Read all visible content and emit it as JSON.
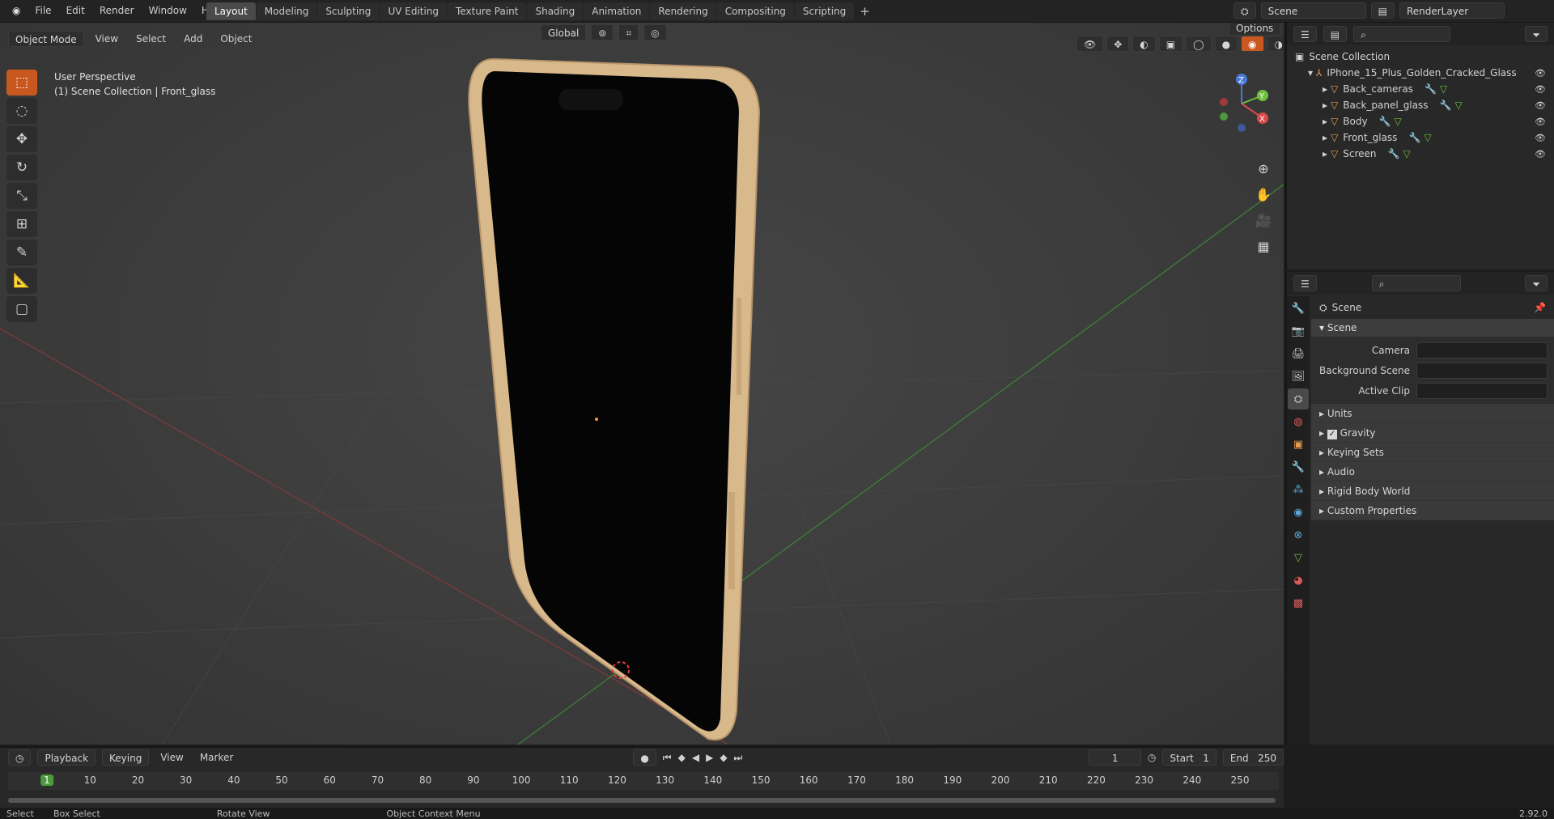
{
  "menu": [
    "File",
    "Edit",
    "Render",
    "Window",
    "Help"
  ],
  "workspace_tabs": [
    "Layout",
    "Modeling",
    "Sculpting",
    "UV Editing",
    "Texture Paint",
    "Shading",
    "Animation",
    "Rendering",
    "Compositing",
    "Scripting"
  ],
  "active_tab": "Layout",
  "scene_name": "Scene",
  "view_layer_name": "RenderLayer",
  "viewport": {
    "mode": "Object Mode",
    "menus": [
      "View",
      "Select",
      "Add",
      "Object"
    ],
    "transform_orientation": "Global",
    "options_label": "Options",
    "overlay_line1": "User Perspective",
    "overlay_line2": "(1) Scene Collection | Front_glass"
  },
  "outliner": {
    "root": "Scene Collection",
    "collection": "IPhone_15_Plus_Golden_Cracked_Glass",
    "objects": [
      "Back_cameras",
      "Back_panel_glass",
      "Body",
      "Front_glass",
      "Screen"
    ]
  },
  "properties": {
    "context_name": "Scene",
    "panel_title": "Scene",
    "fields": [
      {
        "label": "Camera"
      },
      {
        "label": "Background Scene"
      },
      {
        "label": "Active Clip"
      }
    ],
    "subpanels": [
      "Units",
      "Gravity",
      "Keying Sets",
      "Audio",
      "Rigid Body World",
      "Custom Properties"
    ]
  },
  "timeline": {
    "menus": [
      "Playback",
      "Keying",
      "View",
      "Marker"
    ],
    "current_frame": "1",
    "start_label": "Start",
    "start": "1",
    "end_label": "End",
    "end": "250",
    "ticks": [
      "1",
      "10",
      "20",
      "30",
      "40",
      "50",
      "60",
      "70",
      "80",
      "90",
      "100",
      "110",
      "120",
      "130",
      "140",
      "150",
      "160",
      "170",
      "180",
      "190",
      "200",
      "210",
      "220",
      "230",
      "240",
      "250"
    ]
  },
  "status": {
    "items": [
      "Select",
      "Box Select",
      "Rotate View",
      "Object Context Menu"
    ],
    "version": "2.92.0"
  },
  "colors": {
    "accent": "#c9581e",
    "bg": "#1d1d1d",
    "grid_red": "#a33a3a",
    "grid_green": "#4c9a3c"
  }
}
